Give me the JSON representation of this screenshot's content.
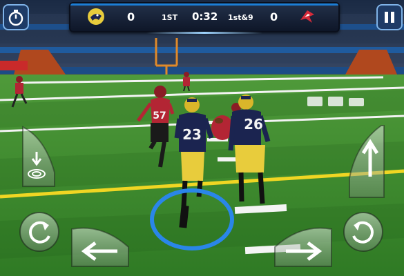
{
  "scoreboard": {
    "home_score": "0",
    "quarter": "1ST",
    "game_clock": "0:32",
    "down_distance": "1st&9",
    "away_score": "0"
  },
  "players": {
    "home_left_number": "23",
    "home_right_number": "26",
    "opponent_number": "57"
  },
  "colors": {
    "field_green": "#3d8a2e",
    "home_jersey": "#1b2450",
    "home_pants": "#e8cc3c",
    "away_jersey": "#b32534",
    "scoreboard_bg": "#131d33",
    "highlight_ring": "#2a86e8"
  },
  "controls": {
    "top_left": "timeout-icon",
    "top_right": "pause-icon",
    "left_side": "dive-icon",
    "right_side": "jump-icon",
    "bottom_left_1": "spin-left-icon",
    "bottom_left_2": "juke-left-icon",
    "bottom_right_1": "juke-right-icon",
    "bottom_right_2": "spin-right-icon"
  }
}
